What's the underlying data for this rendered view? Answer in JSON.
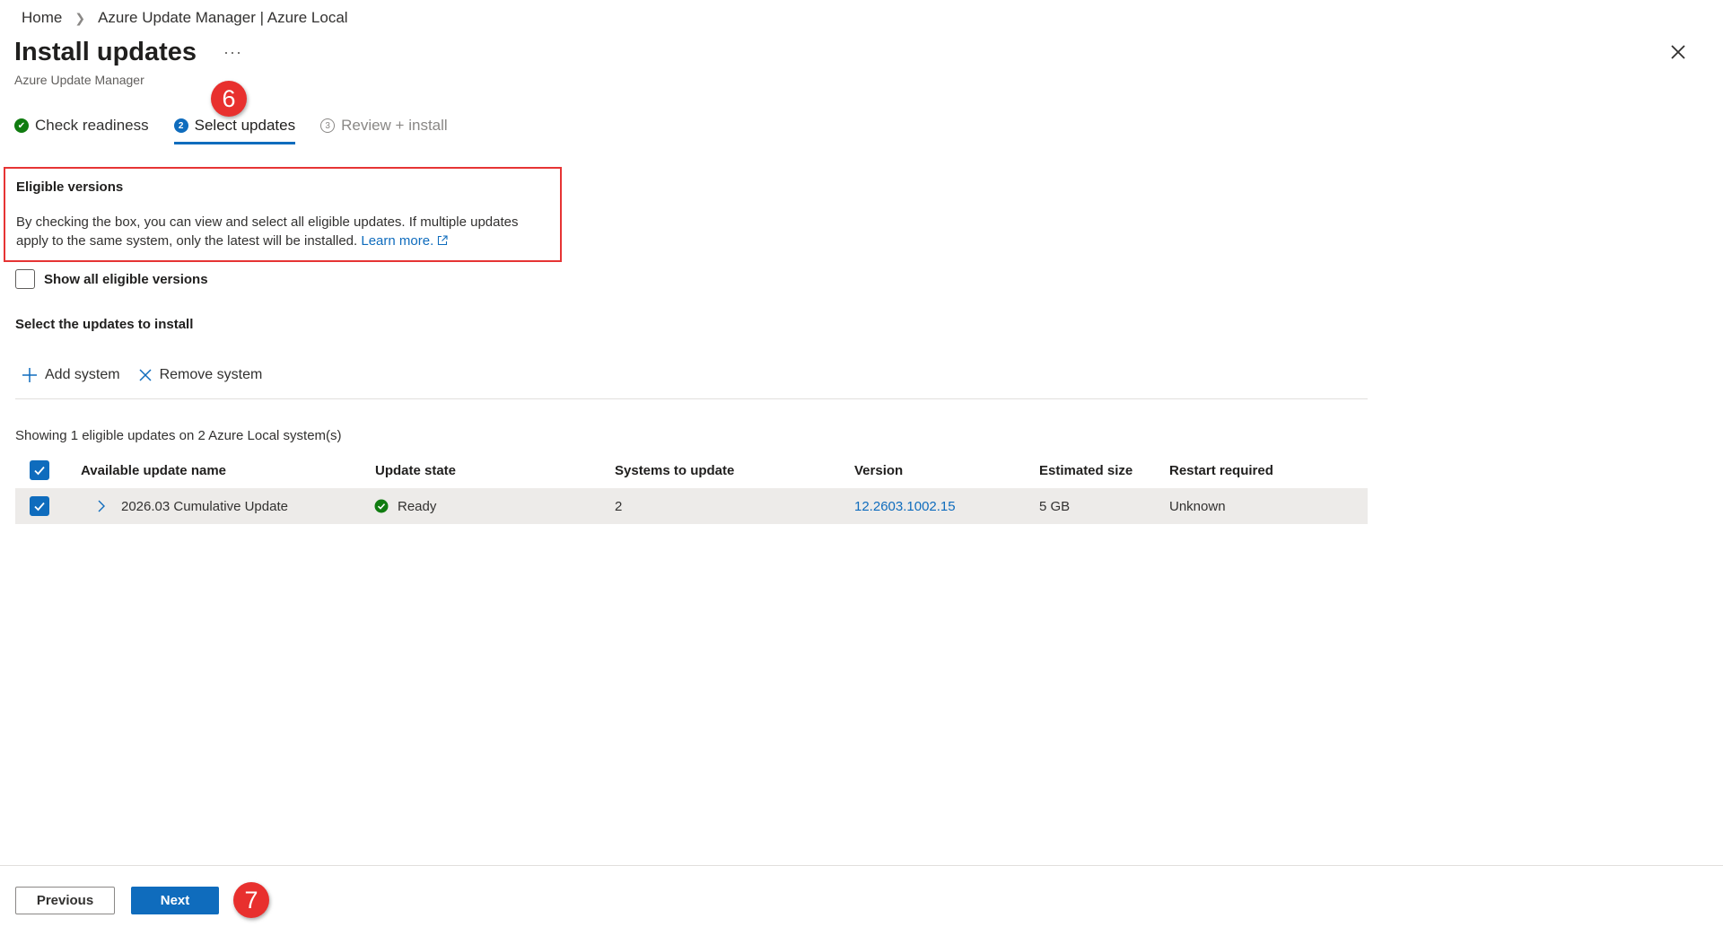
{
  "breadcrumb": {
    "home": "Home",
    "current": "Azure Update Manager | Azure Local"
  },
  "header": {
    "title": "Install updates",
    "more": "···",
    "subtitle": "Azure Update Manager"
  },
  "callouts": {
    "step6": "6",
    "step7": "7"
  },
  "steps": [
    {
      "number": "1",
      "label": "Check readiness",
      "state": "done"
    },
    {
      "number": "2",
      "label": "Select updates",
      "state": "active"
    },
    {
      "number": "3",
      "label": "Review + install",
      "state": "future"
    }
  ],
  "eligible": {
    "title": "Eligible versions",
    "description": "By checking the box, you can view and select all eligible updates. If multiple updates apply to the same system, only the latest will be installed.",
    "learn_more": "Learn more."
  },
  "show_all": {
    "label": "Show all eligible versions",
    "checked": false
  },
  "section_title": "Select the updates to install",
  "toolbar": {
    "add": "Add system",
    "remove": "Remove system"
  },
  "showing_text": "Showing 1 eligible updates on 2 Azure Local system(s)",
  "table": {
    "headers": {
      "name": "Available update name",
      "state": "Update state",
      "systems": "Systems to update",
      "version": "Version",
      "size": "Estimated size",
      "restart": "Restart required"
    },
    "rows": [
      {
        "checked": true,
        "name": "2026.03 Cumulative Update",
        "state": "Ready",
        "systems": "2",
        "version": "12.2603.1002.15",
        "size": "5 GB",
        "restart": "Unknown"
      }
    ]
  },
  "footer": {
    "previous": "Previous",
    "next": "Next"
  },
  "colors": {
    "accent": "#0f6cbd",
    "success": "#107c10",
    "callout": "#e8302e",
    "highlight_border": "#e63434"
  }
}
